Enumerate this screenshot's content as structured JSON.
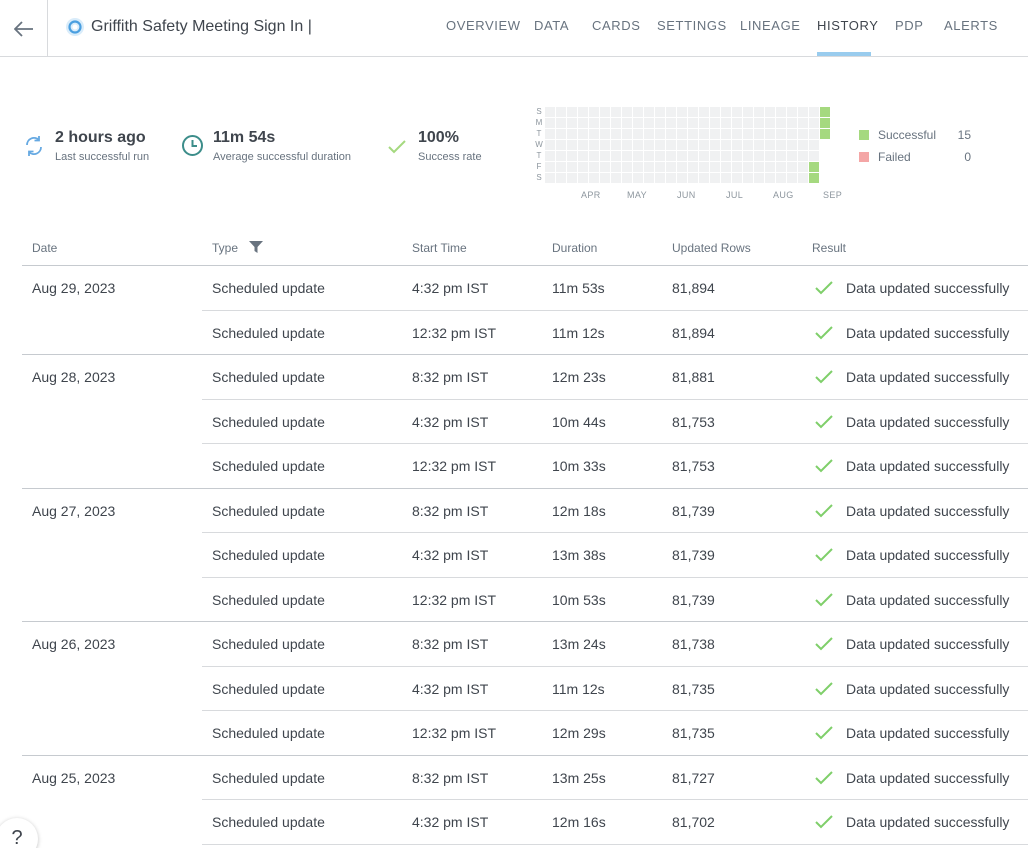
{
  "header": {
    "title": "Griffith Safety Meeting Sign In |",
    "tabs": [
      "OVERVIEW",
      "DATA",
      "CARDS",
      "SETTINGS",
      "LINEAGE",
      "HISTORY",
      "PDP",
      "ALERTS"
    ],
    "active_tab": "HISTORY"
  },
  "stats": {
    "last_run": {
      "value": "2 hours ago",
      "label": "Last successful run"
    },
    "avg_duration": {
      "value": "11m 54s",
      "label": "Average successful duration"
    },
    "success_rate": {
      "value": "100%",
      "label": "Success rate"
    }
  },
  "heatmap": {
    "day_labels": [
      "S",
      "M",
      "T",
      "W",
      "T",
      "F",
      "S"
    ],
    "month_labels": [
      "APR",
      "MAY",
      "JUN",
      "JUL",
      "AUG",
      "SEP"
    ],
    "legend": [
      {
        "label": "Successful",
        "count": "15",
        "color": "#a5d97f"
      },
      {
        "label": "Failed",
        "count": "0",
        "color": "#f4a6a6"
      }
    ]
  },
  "table": {
    "columns": [
      "Date",
      "Type",
      "Start Time",
      "Duration",
      "Updated Rows",
      "Result"
    ],
    "groups": [
      {
        "date": "Aug 29, 2023",
        "rows": [
          {
            "type": "Scheduled update",
            "start": "4:32 pm IST",
            "duration": "11m 53s",
            "rows": "81,894",
            "result": "Data updated successfully"
          },
          {
            "type": "Scheduled update",
            "start": "12:32 pm IST",
            "duration": "11m 12s",
            "rows": "81,894",
            "result": "Data updated successfully"
          }
        ]
      },
      {
        "date": "Aug 28, 2023",
        "rows": [
          {
            "type": "Scheduled update",
            "start": "8:32 pm IST",
            "duration": "12m 23s",
            "rows": "81,881",
            "result": "Data updated successfully"
          },
          {
            "type": "Scheduled update",
            "start": "4:32 pm IST",
            "duration": "10m 44s",
            "rows": "81,753",
            "result": "Data updated successfully"
          },
          {
            "type": "Scheduled update",
            "start": "12:32 pm IST",
            "duration": "10m 33s",
            "rows": "81,753",
            "result": "Data updated successfully"
          }
        ]
      },
      {
        "date": "Aug 27, 2023",
        "rows": [
          {
            "type": "Scheduled update",
            "start": "8:32 pm IST",
            "duration": "12m 18s",
            "rows": "81,739",
            "result": "Data updated successfully"
          },
          {
            "type": "Scheduled update",
            "start": "4:32 pm IST",
            "duration": "13m 38s",
            "rows": "81,739",
            "result": "Data updated successfully"
          },
          {
            "type": "Scheduled update",
            "start": "12:32 pm IST",
            "duration": "10m 53s",
            "rows": "81,739",
            "result": "Data updated successfully"
          }
        ]
      },
      {
        "date": "Aug 26, 2023",
        "rows": [
          {
            "type": "Scheduled update",
            "start": "8:32 pm IST",
            "duration": "13m 24s",
            "rows": "81,738",
            "result": "Data updated successfully"
          },
          {
            "type": "Scheduled update",
            "start": "4:32 pm IST",
            "duration": "11m 12s",
            "rows": "81,735",
            "result": "Data updated successfully"
          },
          {
            "type": "Scheduled update",
            "start": "12:32 pm IST",
            "duration": "12m 29s",
            "rows": "81,735",
            "result": "Data updated successfully"
          }
        ]
      },
      {
        "date": "Aug 25, 2023",
        "rows": [
          {
            "type": "Scheduled update",
            "start": "8:32 pm IST",
            "duration": "13m 25s",
            "rows": "81,727",
            "result": "Data updated successfully"
          },
          {
            "type": "Scheduled update",
            "start": "4:32 pm IST",
            "duration": "12m 16s",
            "rows": "81,702",
            "result": "Data updated successfully"
          }
        ]
      }
    ]
  },
  "help": {
    "label": "?"
  }
}
